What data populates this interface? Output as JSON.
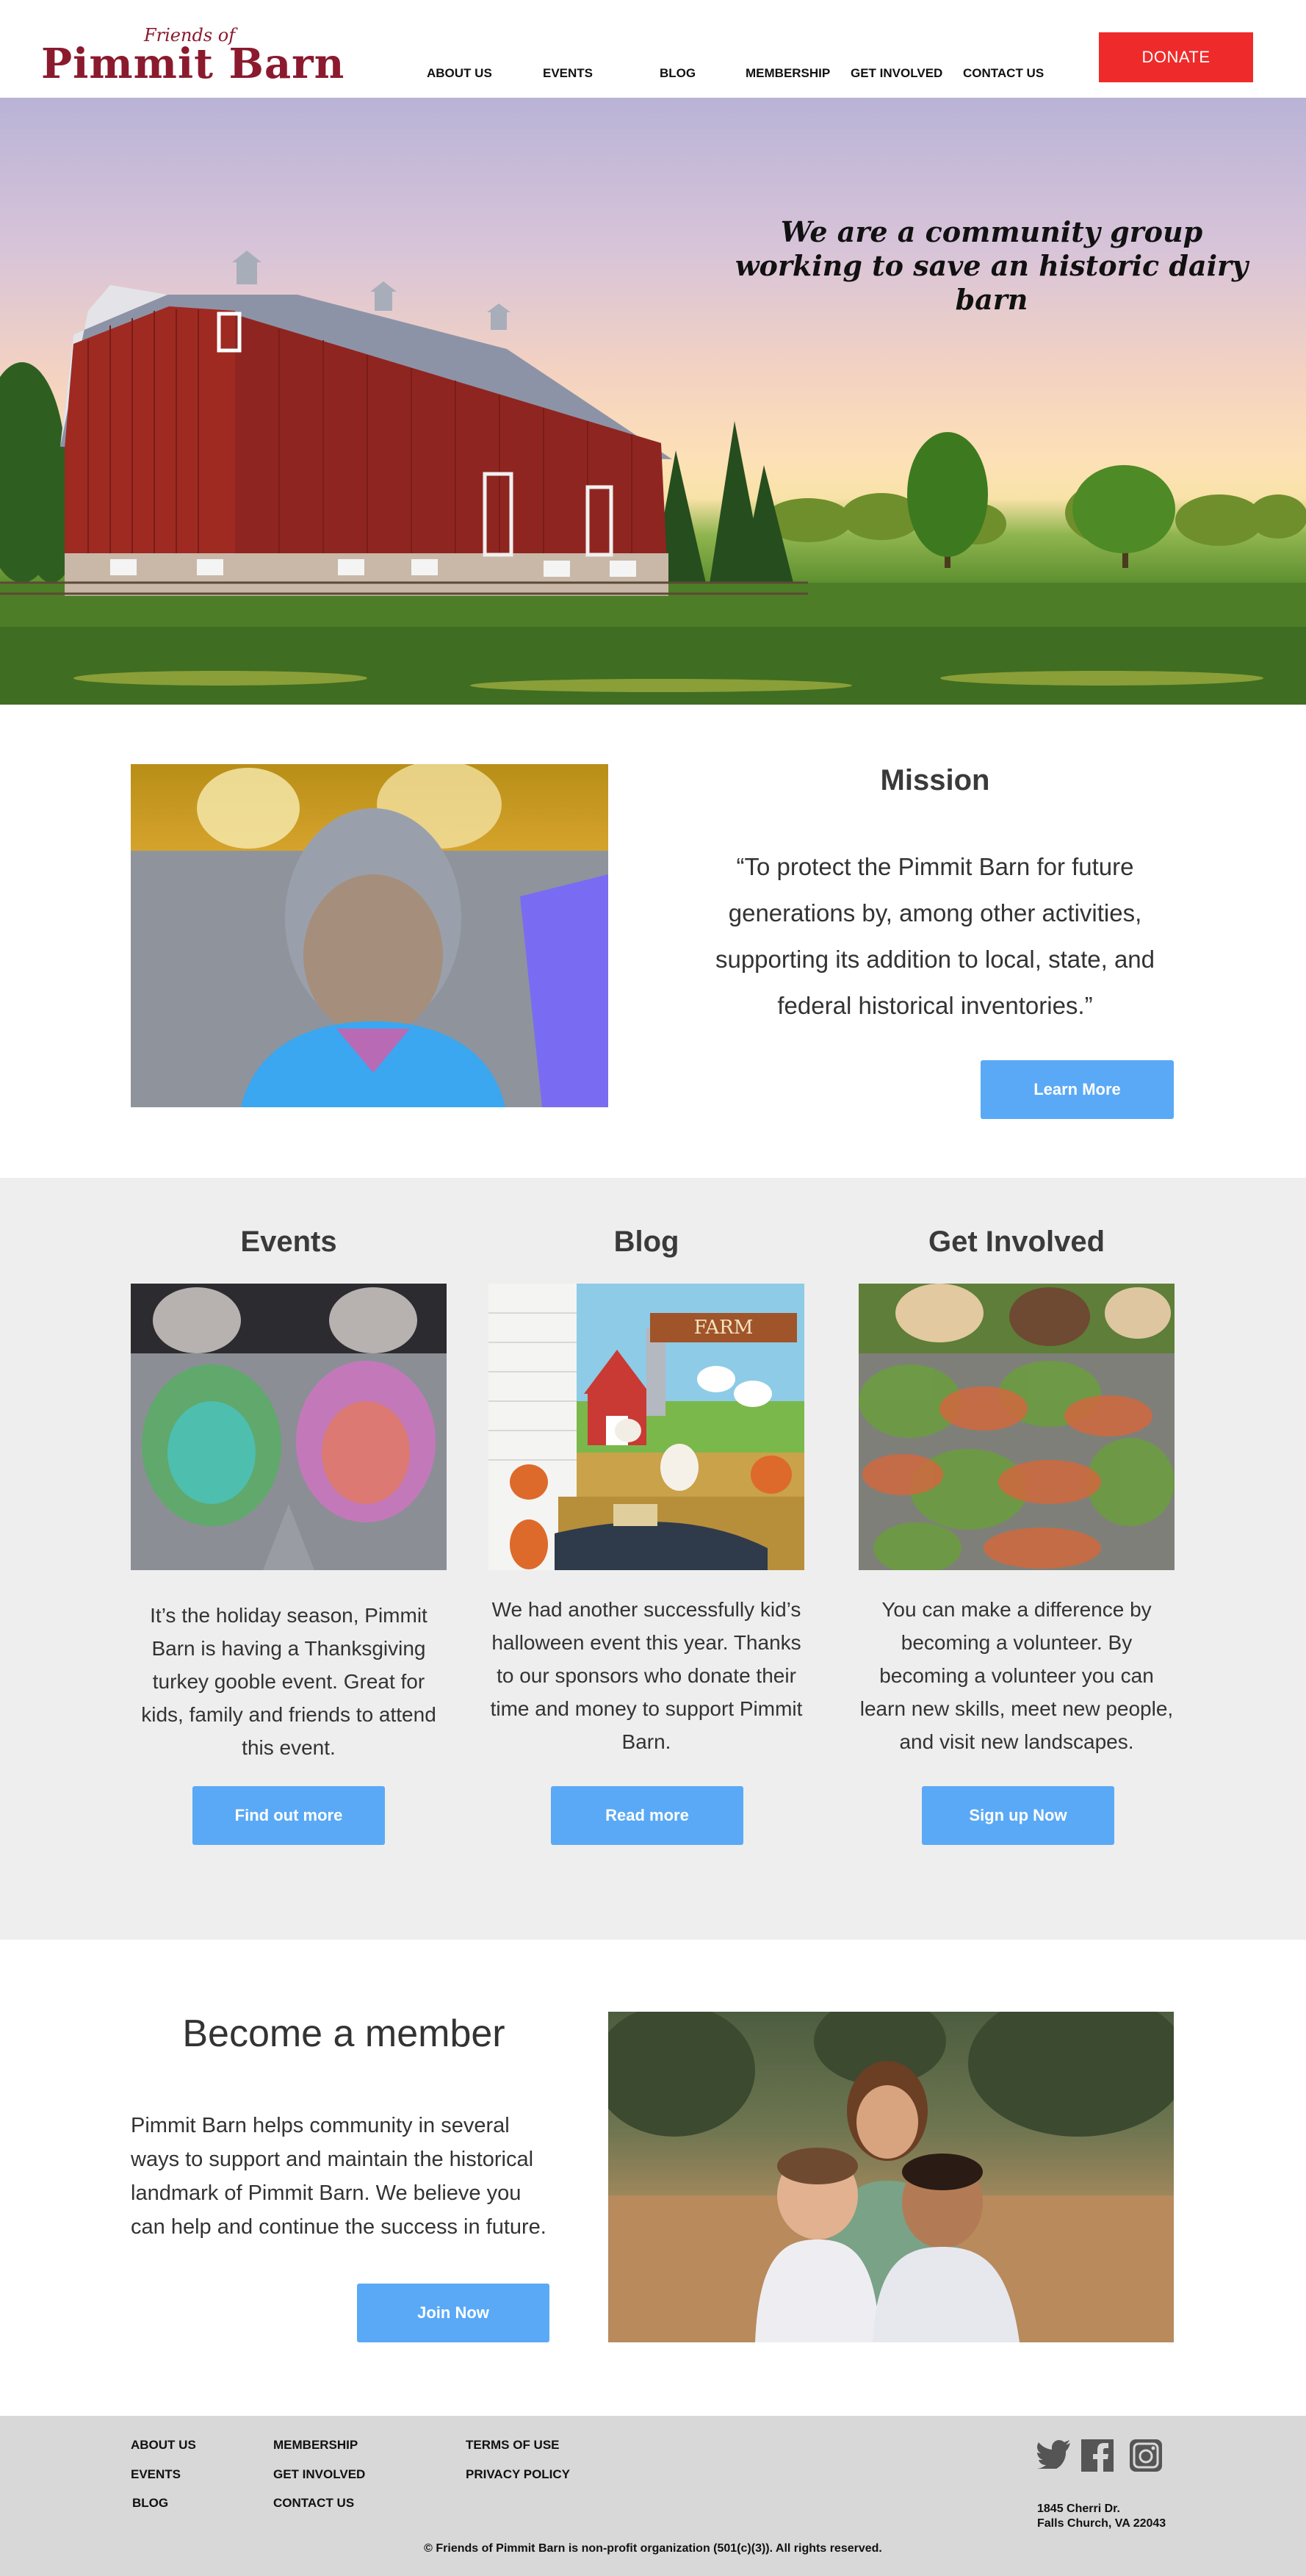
{
  "header": {
    "logo_small": "Friends of",
    "logo_big": "Pimmit Barn",
    "nav": [
      "ABOUT US",
      "EVENTS",
      "BLOG",
      "MEMBERSHIP",
      "GET INVOLVED",
      "CONTACT US"
    ],
    "donate_label": "DONATE"
  },
  "hero": {
    "tagline_line1": "We are a community group",
    "tagline_line2": "working to save an historic dairy barn"
  },
  "mission": {
    "title": "Mission",
    "quote": "“To protect the Pimmit Barn for future generations by, among other activities, supporting its addition to local, state, and federal historical inventories.”",
    "button": "Learn More"
  },
  "cards": [
    {
      "title": "Events",
      "text": "It’s the holiday season, Pimmit Barn is having a Thanksgiving turkey gooble event. Great for kids, family and friends to attend this event.",
      "button": "Find out more"
    },
    {
      "title": "Blog",
      "text": "We had another successfully kid’s halloween event this year. Thanks to our sponsors who donate their time and money to support Pimmit Barn.",
      "button": "Read  more",
      "sign_text": "FARM"
    },
    {
      "title": "Get Involved",
      "text": "You can make a difference by becoming a volunteer. By becoming a volunteer you can learn new skills, meet new people, and visit new landscapes.",
      "button": "Sign up Now"
    }
  ],
  "member": {
    "title": "Become a member",
    "text": "Pimmit Barn helps community in several ways to support and maintain the historical landmark of Pimmit Barn. We believe you can help and continue the success in future.",
    "button": "Join Now"
  },
  "footer": {
    "col1": [
      "ABOUT US",
      "EVENTS",
      "BLOG"
    ],
    "col2": [
      "MEMBERSHIP",
      "GET INVOLVED",
      "CONTACT US"
    ],
    "col3": [
      "TERMS OF USE",
      "PRIVACY POLICY"
    ],
    "address_line1": "1845 Cherri Dr.",
    "address_line2": "Falls Church, VA 22043",
    "copyright": "© Friends of Pimmit Barn is non-profit organization (501(c)(3)). All rights reserved.",
    "social_icons": [
      "twitter-icon",
      "facebook-icon",
      "instagram-icon"
    ]
  },
  "colors": {
    "brand": "#8b1a2e",
    "donate": "#ef2a2a",
    "button": "#5aa9f6",
    "section_gray": "#eeeeee",
    "footer_gray": "#d8d8d8"
  }
}
